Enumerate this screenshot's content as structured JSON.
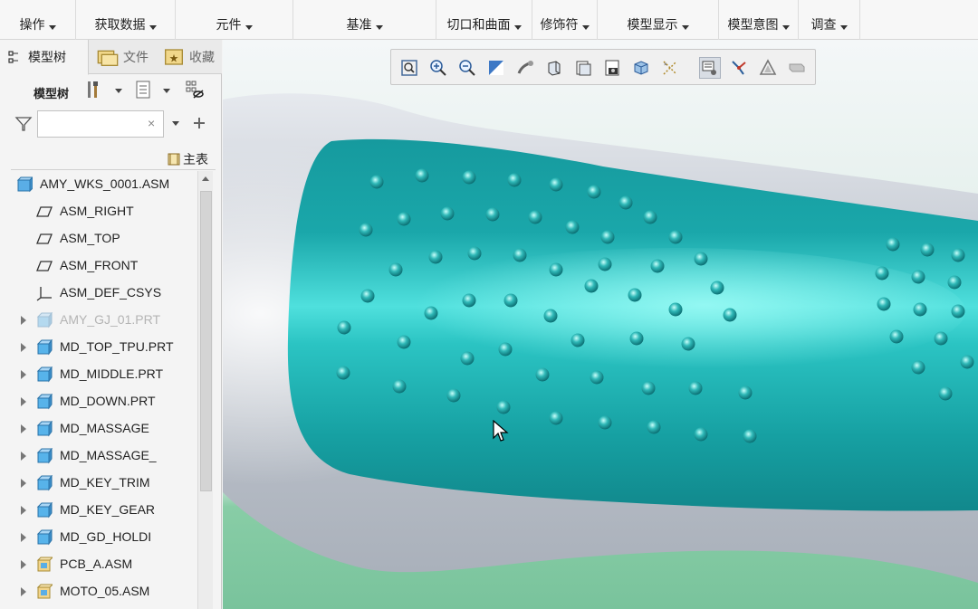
{
  "ribbon": {
    "groups": [
      {
        "label": "操作",
        "name": "ribbon-operations"
      },
      {
        "label": "获取数据",
        "name": "ribbon-get-data"
      },
      {
        "label": "元件",
        "name": "ribbon-component"
      },
      {
        "label": "基准",
        "name": "ribbon-datum"
      },
      {
        "label": "切口和曲面",
        "name": "ribbon-cut-surface"
      },
      {
        "label": "修饰符",
        "name": "ribbon-modifiers"
      },
      {
        "label": "模型显示",
        "name": "ribbon-model-display"
      },
      {
        "label": "模型意图",
        "name": "ribbon-model-intent"
      },
      {
        "label": "调查",
        "name": "ribbon-investigate"
      }
    ]
  },
  "panel": {
    "tabs": [
      {
        "label": "模型树",
        "icon": "model-tree-icon"
      },
      {
        "label": "文件",
        "icon": "folder-icon"
      },
      {
        "label": "收藏",
        "icon": "favorites-icon"
      }
    ],
    "toolbar_label": "模型树",
    "search": {
      "placeholder": "",
      "clear": "×"
    },
    "column_header": "主表",
    "tree": [
      {
        "label": "AMY_WKS_0001.ASM",
        "icon": "assembly-icon",
        "expand": false,
        "dim": false,
        "indent": 0
      },
      {
        "label": "ASM_RIGHT",
        "icon": "datum-plane-icon",
        "expand": false,
        "dim": false,
        "indent": 1
      },
      {
        "label": "ASM_TOP",
        "icon": "datum-plane-icon",
        "expand": false,
        "dim": false,
        "indent": 1
      },
      {
        "label": "ASM_FRONT",
        "icon": "datum-plane-icon",
        "expand": false,
        "dim": false,
        "indent": 1
      },
      {
        "label": "ASM_DEF_CSYS",
        "icon": "csys-icon",
        "expand": false,
        "dim": false,
        "indent": 1
      },
      {
        "label": "AMY_GJ_01.PRT",
        "icon": "part-icon",
        "expand": true,
        "dim": true,
        "indent": 1
      },
      {
        "label": "MD_TOP_TPU.PRT",
        "icon": "part-icon",
        "expand": true,
        "dim": false,
        "indent": 1
      },
      {
        "label": "MD_MIDDLE.PRT",
        "icon": "part-icon",
        "expand": true,
        "dim": false,
        "indent": 1
      },
      {
        "label": "MD_DOWN.PRT",
        "icon": "part-icon",
        "expand": true,
        "dim": false,
        "indent": 1
      },
      {
        "label": "MD_MASSAGE",
        "icon": "part-icon",
        "expand": true,
        "dim": false,
        "indent": 1
      },
      {
        "label": "MD_MASSAGE_",
        "icon": "part-icon",
        "expand": true,
        "dim": false,
        "indent": 1
      },
      {
        "label": "MD_KEY_TRIM",
        "icon": "part-icon",
        "expand": true,
        "dim": false,
        "indent": 1
      },
      {
        "label": "MD_KEY_GEAR",
        "icon": "part-icon",
        "expand": true,
        "dim": false,
        "indent": 1
      },
      {
        "label": "MD_GD_HOLDI",
        "icon": "part-icon",
        "expand": true,
        "dim": false,
        "indent": 1
      },
      {
        "label": "PCB_A.ASM",
        "icon": "subassembly-icon",
        "expand": true,
        "dim": false,
        "indent": 1
      },
      {
        "label": "MOTO_05.ASM",
        "icon": "subassembly-icon",
        "expand": true,
        "dim": false,
        "indent": 1
      }
    ]
  },
  "graphics_toolbar": [
    "refit-icon",
    "zoom-in-icon",
    "zoom-out-icon",
    "repaint-icon",
    "pan-icon",
    "display-style-icon",
    "saved-views-icon",
    "view-manager-icon",
    "perspective-icon",
    "datum-display-icon",
    "spin-center-icon",
    "annotation-display-icon",
    "wireframe-icon",
    "appearance-icon"
  ],
  "colors": {
    "part_teal": "#17a9ab",
    "part_highlight": "#7ff5f0",
    "shell_grey": "#c9ced6",
    "background_top": "#f4f7f8",
    "background_bottom": "#7fc79f"
  }
}
